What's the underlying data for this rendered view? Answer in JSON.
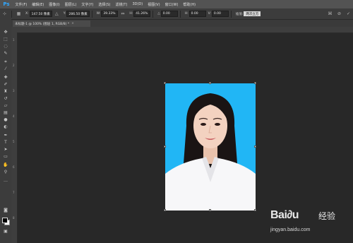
{
  "app": {
    "logo": "Ps"
  },
  "menubar": {
    "items": [
      "文件(F)",
      "编辑(E)",
      "图像(I)",
      "图层(L)",
      "文字(Y)",
      "选择(S)",
      "滤镜(T)",
      "3D(D)",
      "视图(V)",
      "窗口(W)",
      "帮助(H)"
    ]
  },
  "options": {
    "x_label": "X:",
    "x_value": "147.50 像素",
    "y_label": "Y:",
    "y_value": "286.50 像素",
    "w_label": "W:",
    "w_value": "39.33%",
    "h_label": "H:",
    "h_value": "41.26%",
    "angle_label": "△",
    "angle_value": "0.00",
    "hskew_label": "H:",
    "hskew_value": "0.00",
    "vskew_label": "V:",
    "vskew_value": "0.00",
    "interp_label": "插值:",
    "interp_value": "两次立方"
  },
  "document_tab": {
    "title": "未标题-1 @ 100% (图层 1, RGB/8) *",
    "close": "×"
  },
  "ruler": {
    "left_labels": [
      "1",
      "2",
      "3",
      "4",
      "5",
      "6",
      "7",
      "8"
    ]
  },
  "watermark": {
    "brand": "Bai∂u",
    "jingyan": "经验",
    "url": "jingyan.baidu.com"
  }
}
